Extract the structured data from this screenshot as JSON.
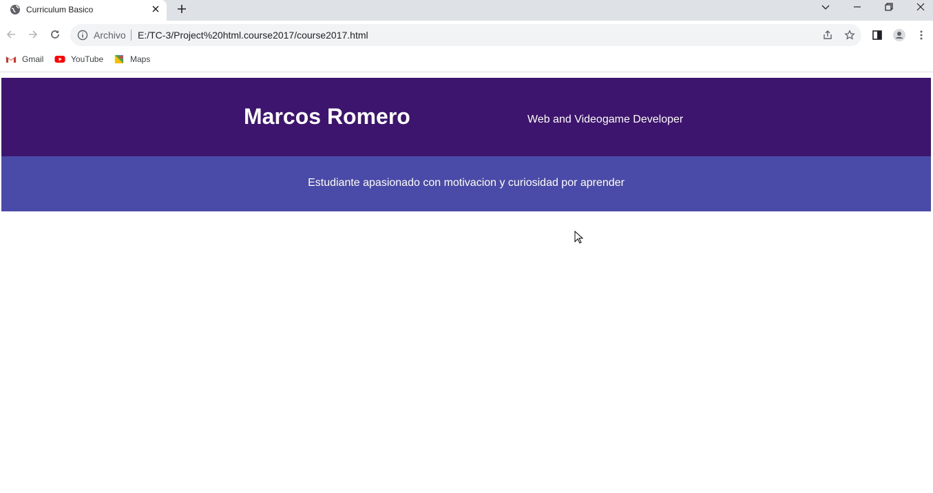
{
  "browser": {
    "tab": {
      "title": "Curriculum Basico",
      "favicon": "globe-icon"
    },
    "omnibox": {
      "label": "Archivo",
      "url": "E:/TC-3/Project%20html.course2017/course2017.html"
    },
    "bookmarks": [
      {
        "label": "Gmail",
        "icon": "gmail-icon"
      },
      {
        "label": "YouTube",
        "icon": "youtube-icon"
      },
      {
        "label": "Maps",
        "icon": "maps-icon"
      }
    ]
  },
  "page": {
    "name": "Marcos Romero",
    "role": "Web and Videogame Developer",
    "tagline": "Estudiante apasionado con motivacion y curiosidad por aprender"
  },
  "colors": {
    "header_band": "#3d146e",
    "tagline_band": "#4a4aa8",
    "text": "#ffffff"
  }
}
